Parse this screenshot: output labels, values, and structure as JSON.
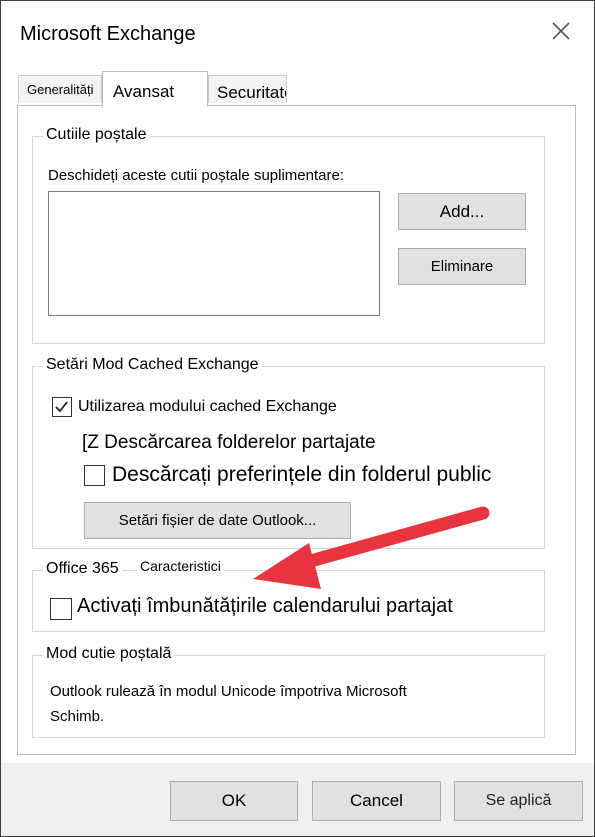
{
  "window": {
    "title": "Microsoft Exchange",
    "close_icon": "close-icon"
  },
  "tabs": [
    {
      "label": "Generalități",
      "active": false
    },
    {
      "label": "Avansat",
      "active": true
    },
    {
      "label": "Securitate",
      "active": false
    }
  ],
  "mailboxes": {
    "group_label": "Cutiile poștale",
    "instruction": "Deschideți aceste cutii poștale suplimentare:",
    "add_button": "Add...",
    "remove_button": "Eliminare"
  },
  "cached": {
    "group_label": "Setări Mod Cached Exchange",
    "use_cached": {
      "label": "Utilizarea modului cached Exchange",
      "checked": true
    },
    "download_shared": {
      "label": "[Z Descărcarea folderelor partajate"
    },
    "download_public": {
      "label": "Descărcați preferințele din folderul public",
      "checked": false
    },
    "data_file_button": "Setări fișier de date Outlook..."
  },
  "office365": {
    "group_label": "Office 365",
    "features_label": "Caracteristici",
    "shared_calendar": {
      "label": "Activați îmbunătățirile calendarului partajat",
      "checked": false
    }
  },
  "mailbox_mode": {
    "group_label": "Mod cutie poștală",
    "line1": "Outlook rulează în modul Unicode împotriva Microsoft",
    "line2": "Schimb."
  },
  "footer": {
    "ok": "OK",
    "cancel": "Cancel",
    "apply": "Se aplică"
  },
  "colors": {
    "arrow": "#e8343f",
    "button_bg": "#e1e1e1",
    "footer_bg": "#f0f0f0"
  }
}
